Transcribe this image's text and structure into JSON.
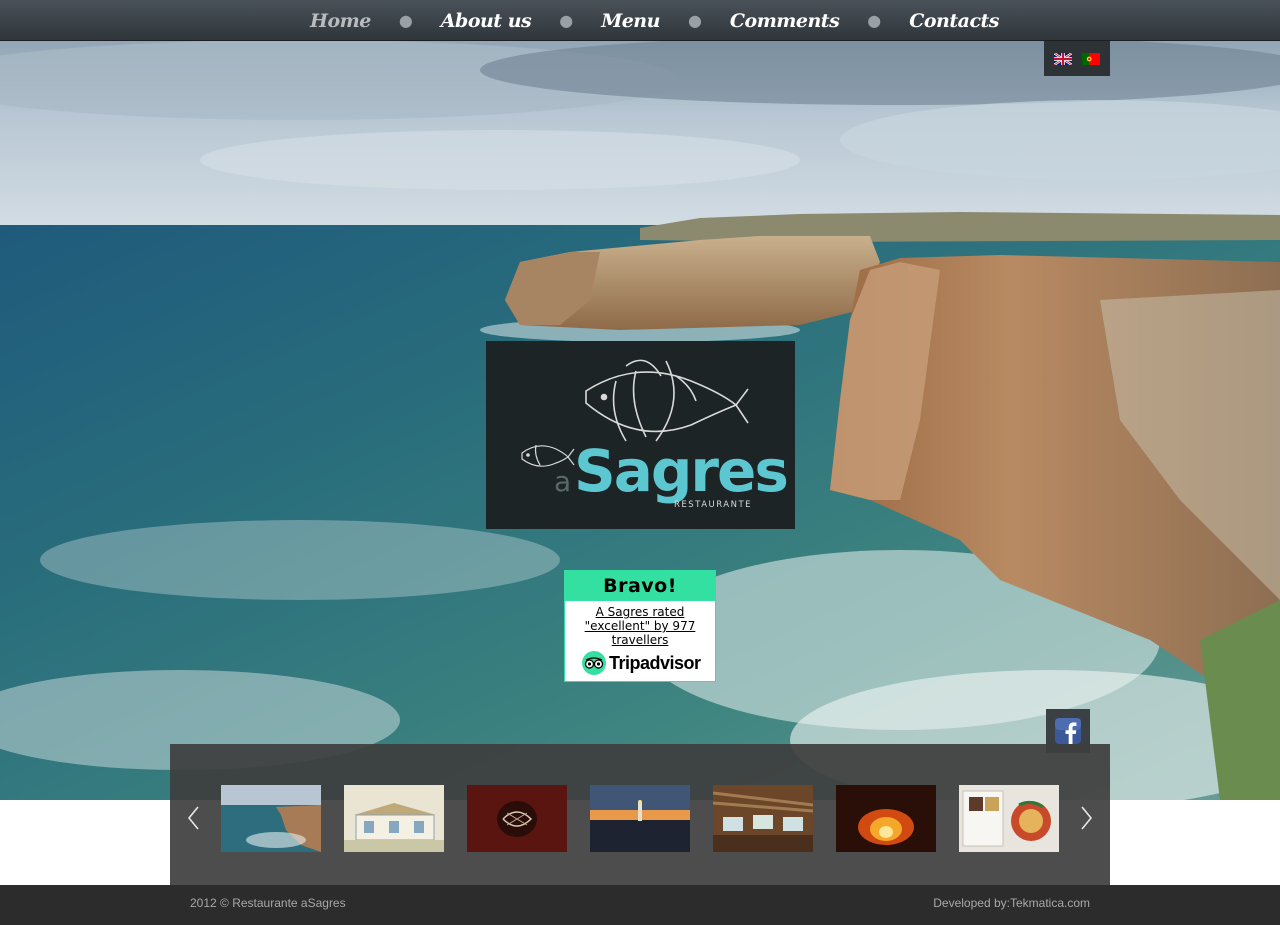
{
  "nav": {
    "items": [
      {
        "label": "Home",
        "active": true
      },
      {
        "label": "About us",
        "active": false
      },
      {
        "label": "Menu",
        "active": false
      },
      {
        "label": "Comments",
        "active": false
      },
      {
        "label": "Contacts",
        "active": false
      }
    ],
    "separator": "●"
  },
  "languages": [
    {
      "icon": "uk-flag-icon"
    },
    {
      "icon": "portugal-flag-icon"
    }
  ],
  "logo": {
    "brand_prefix": "a",
    "brand_name": "Sagres",
    "subtitle": "RESTAURANTE",
    "colors": {
      "accent": "#5cc7d0",
      "background": "#1c2425"
    }
  },
  "tripadvisor": {
    "heading": "Bravo!",
    "rating_text": "A Sagres rated \"excellent\" by 977 travellers",
    "brand": "Tripadvisor",
    "colors": {
      "accent": "#34e0a1"
    }
  },
  "social": {
    "icon": "facebook-icon"
  },
  "gallery": {
    "prev_icon": "chevron-left-icon",
    "next_icon": "chevron-right-icon",
    "thumbnails": [
      {
        "subject": "coastal-cliffs"
      },
      {
        "subject": "restaurant-building-sketch"
      },
      {
        "subject": "fish-artwork"
      },
      {
        "subject": "lighthouse-sunset"
      },
      {
        "subject": "dining-room"
      },
      {
        "subject": "fireplace"
      },
      {
        "subject": "menu-magazine"
      }
    ]
  },
  "footer": {
    "copyright": "2012 © Restaurante aSagres",
    "developer_label": "Developed by:",
    "developer_link": "Tekmatica.com"
  }
}
